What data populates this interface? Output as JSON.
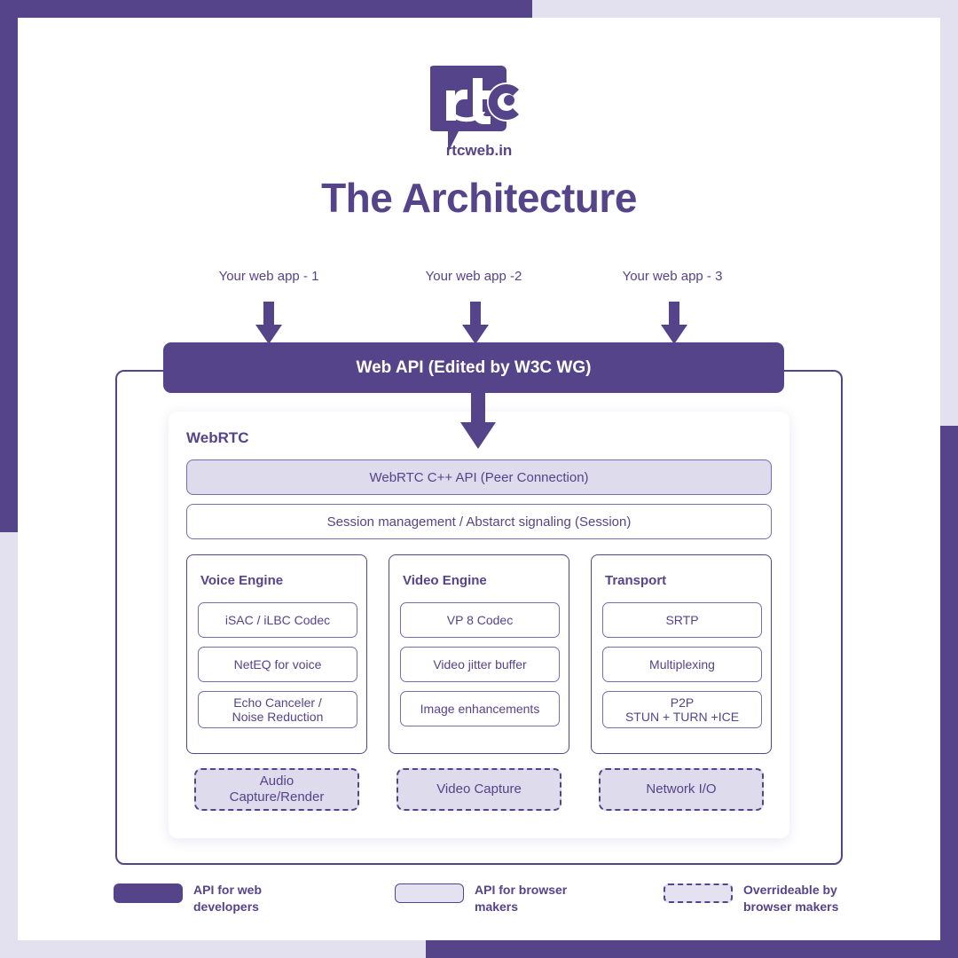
{
  "theme": {
    "purple": "#554489",
    "light_purple_fill": "#dedbec",
    "border_purple": "#7a6bab",
    "page_background": "#e3e1ef",
    "card_background": "#ffffff"
  },
  "logo": {
    "mark_text": "rt",
    "mark_letter_c": "c",
    "wordmark": "rtcweb.in",
    "icon_name": "rtcweb-logo"
  },
  "title": "The Architecture",
  "web_apps": [
    {
      "label": "Your web app - 1"
    },
    {
      "label": "Your web app -2"
    },
    {
      "label": "Your web app - 3"
    }
  ],
  "web_api_bar": {
    "label": "Web API (Edited by W3C WG)"
  },
  "webrtc": {
    "heading": "WebRTC",
    "bars": [
      {
        "label": "WebRTC C++ API (Peer Connection)",
        "style": "filled"
      },
      {
        "label": "Session management / Abstarct signaling (Session)",
        "style": "outline"
      }
    ],
    "engines": [
      {
        "title": "Voice Engine",
        "items": [
          "iSAC / iLBC Codec",
          "NetEQ for voice",
          "Echo Canceler /\nNoise Reduction"
        ]
      },
      {
        "title": "Video Engine",
        "items": [
          "VP 8 Codec",
          "Video jitter buffer",
          "Image enhancements"
        ]
      },
      {
        "title": "Transport",
        "items": [
          "SRTP",
          "Multiplexing",
          "P2P\nSTUN + TURN +ICE"
        ]
      }
    ],
    "overrideable": [
      "Audio\nCapture/Render",
      "Video Capture",
      "Network I/O"
    ]
  },
  "legend": [
    {
      "label": "API for web\ndevelopers",
      "swatch": "solid"
    },
    {
      "label": "API for browser\nmakers",
      "swatch": "light"
    },
    {
      "label": "Overrideable by\nbrowser makers",
      "swatch": "dashed"
    }
  ]
}
